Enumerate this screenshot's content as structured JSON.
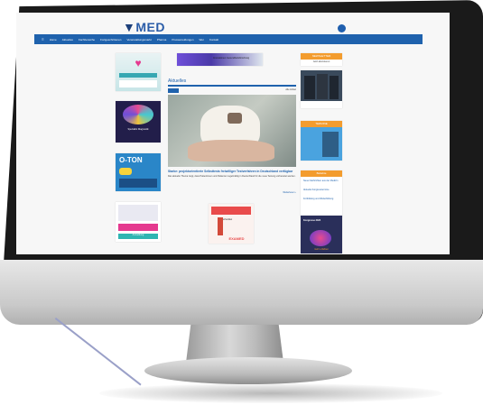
{
  "logo": {
    "text": "MED"
  },
  "nav": {
    "items": [
      "Home",
      "Aktuelles",
      "Fachbereiche",
      "Fortgeschrittenen",
      "Veranstaltungsmarkt",
      "Pharma",
      "Pressemeldungen",
      "Wer",
      "Kontakt"
    ]
  },
  "main": {
    "section_title": "Aktuelles",
    "more_link": "Alle Artikel",
    "article_headline": "Starke: projektorientierte Selbsttests freiwilliger Testverfahren in Deutschland verfügbar",
    "article_text": "Das aktuelle Thema zeigt, dass Patientinnen und Patienten regelmäßig in Deutschland für die neue Testung vorbereitet werden.",
    "read_more": "Weiterlesen ›"
  },
  "ads": {
    "top_banner": "Innovationen Gesundheitsforschung",
    "left_mid_caption": "Spezialist Diagnostik",
    "o_ton": "O-TON",
    "left_bottom_caption": "Anmeldung",
    "center_ad_caption": "Fachartikel",
    "center_ad_brand": "EXAMED"
  },
  "sidebar": {
    "top_title": "NEWSLETTER",
    "top_subtitle": "Jetzt abonnieren",
    "mid_title": "TERMINE",
    "list_title": "Beliebte",
    "list_items": [
      "Neue Nachrichten aus der Medizin",
      "Aktuelle Kongresstermine",
      "Fortbildung und Weiterbildung"
    ],
    "bottom_ad_title": "Kongresse 2024",
    "bottom_ad_subtitle": "mehr erfahren"
  },
  "colors": {
    "nav_blue": "#1f62ad",
    "accent_orange": "#f39c2e",
    "dark_ad": "#2a2f5a"
  }
}
